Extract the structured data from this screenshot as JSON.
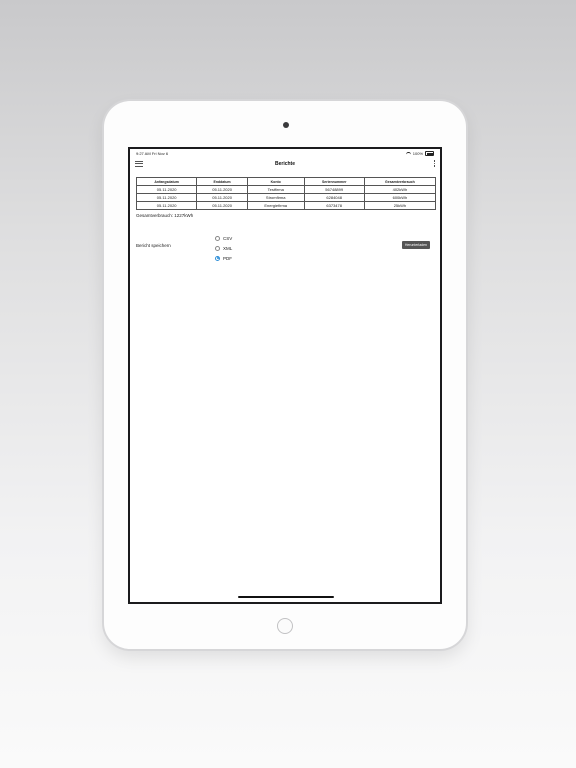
{
  "status_bar": {
    "time": "9:27 AM",
    "date": "Fri Nov 6",
    "battery": "100%"
  },
  "nav": {
    "title": "Berichte",
    "menu_icon": "hamburger-menu-icon",
    "more_icon": "vertical-dots-icon"
  },
  "table": {
    "headers": [
      "Anfangsdatum",
      "Enddatum",
      "Konto",
      "Seriennummer",
      "Gesamtverbrauch"
    ],
    "rows": [
      [
        "05.11.2020",
        "05.11.2020",
        "Testfirma",
        "56748899",
        "402kWh"
      ],
      [
        "05.11.2020",
        "05.11.2020",
        "Stromfirma",
        "6284048",
        "600kWh"
      ],
      [
        "05.11.2020",
        "05.11.2020",
        "Energiefirma",
        "6373478",
        "25kWh"
      ]
    ]
  },
  "total": {
    "label": "Gesamtverbrauch:",
    "value": "1227kWh"
  },
  "save": {
    "label": "Bericht speichern",
    "options": [
      "CSV",
      "XML",
      "PDF"
    ],
    "selected_index": 2,
    "button_label": "Herunterladen"
  },
  "colors": {
    "accent": "#2f8fd8",
    "button_bg": "#555555"
  }
}
